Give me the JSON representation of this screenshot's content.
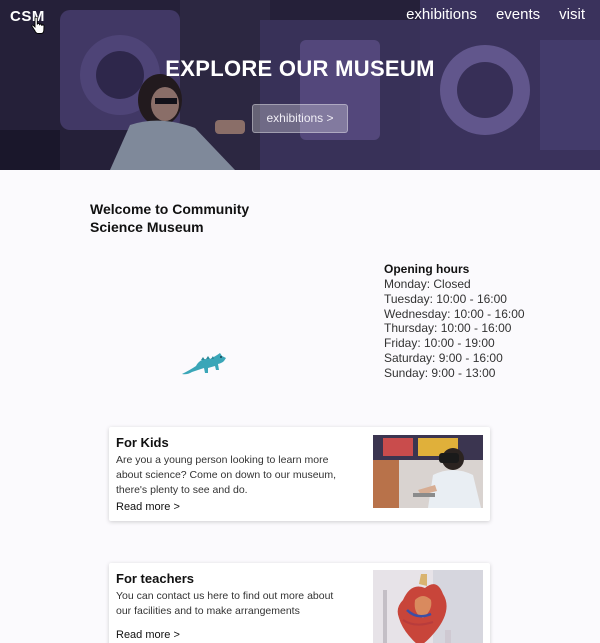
{
  "header": {
    "logo": "CSM",
    "nav": [
      "exhibitions",
      "events",
      "visit"
    ]
  },
  "hero": {
    "title": "EXPLORE OUR MUSEUM",
    "button": "exhibitions >"
  },
  "welcome": {
    "heading": "Welcome to Community Science Museum"
  },
  "hours": {
    "title": "Opening hours",
    "days": [
      "Monday: Closed",
      "Tuesday: 10:00 - 16:00",
      "Wednesday: 10:00 - 16:00",
      "Thursday: 10:00 - 16:00",
      "Friday: 10:00 - 19:00",
      "Saturday: 9:00 - 16:00",
      "Sunday: 9:00 - 13:00"
    ]
  },
  "cards": [
    {
      "title": "For Kids",
      "text": "Are you a young person looking to learn more about science? Come on down to our museum, there's plenty to see and do.",
      "link": "Read more >"
    },
    {
      "title": "For teachers",
      "text": "You can contact us here to find out more about our facilities and to make arrangements",
      "link": "Read more >"
    }
  ],
  "colors": {
    "hero_tint": "#4b3f78",
    "dino": "#3aa6b8",
    "background": "#fbfafd"
  },
  "icons": [
    "pointer-cursor-icon",
    "dinosaur-icon"
  ]
}
